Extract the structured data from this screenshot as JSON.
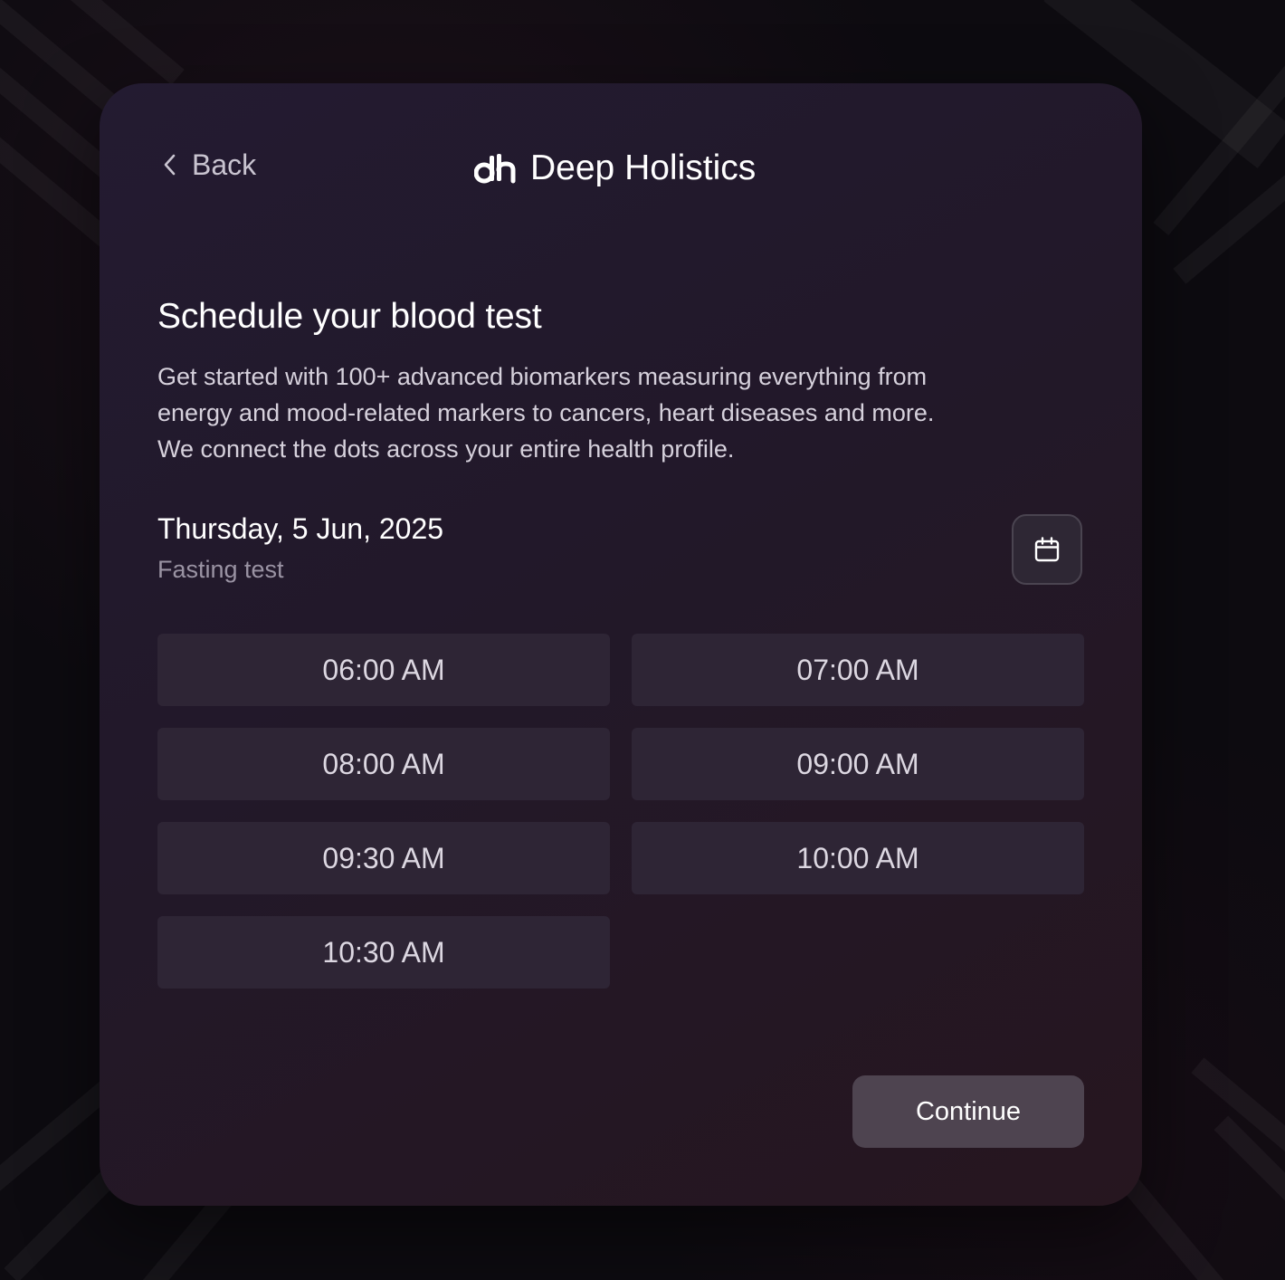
{
  "nav": {
    "back_label": "Back"
  },
  "brand": {
    "name": "Deep Holistics",
    "logo_text": "dh"
  },
  "page": {
    "title": "Schedule your blood test",
    "description": "Get started with 100+ advanced biomarkers measuring everything from energy and mood-related markers to cancers, heart diseases and more. We connect the dots across your entire health profile."
  },
  "appointment": {
    "date": "Thursday, 5 Jun, 2025",
    "test_type": "Fasting test",
    "calendar_icon": "calendar-icon"
  },
  "time_slots": [
    {
      "label": "06:00 AM"
    },
    {
      "label": "07:00 AM"
    },
    {
      "label": "08:00 AM"
    },
    {
      "label": "09:00 AM"
    },
    {
      "label": "09:30 AM"
    },
    {
      "label": "10:00 AM"
    },
    {
      "label": "10:30 AM"
    }
  ],
  "actions": {
    "continue_label": "Continue"
  },
  "colors": {
    "card_background": "#231b31",
    "slot_background": "#2e2535",
    "continue_background": "#4e4450",
    "text_primary": "#ffffff",
    "text_muted": "#9a93a3"
  }
}
